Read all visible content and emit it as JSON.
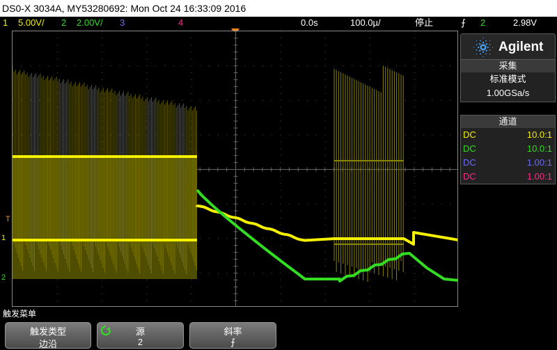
{
  "title": "DS0-X 3034A, MY53280692: Mon Oct 24 16:33:09 2016",
  "status": {
    "ch1_num": "1",
    "ch1_scale": "5.00V/",
    "ch2_num": "2",
    "ch2_scale": "2.00V/",
    "ch3_num": "3",
    "ch4_num": "4",
    "delay": "0.0s",
    "timebase": "100.0µ/",
    "run_state": "停止",
    "trig_slope_symbol": "⨍",
    "trig_source": "2",
    "trig_level": "2.98V"
  },
  "markers": {
    "trigger": "T",
    "ch1": "1",
    "ch2": "2"
  },
  "logo": {
    "brand": "Agilent"
  },
  "acquisition": {
    "header": "采集",
    "mode": "标准模式",
    "rate": "1.00GSa/s"
  },
  "channels": {
    "header": "通道",
    "rows": [
      {
        "coupling": "DC",
        "probe": "10.0:1",
        "color": "#f5f000"
      },
      {
        "coupling": "DC",
        "probe": "10.0:1",
        "color": "#33dd22"
      },
      {
        "coupling": "DC",
        "probe": "1.00:1",
        "color": "#6a6aff"
      },
      {
        "coupling": "DC",
        "probe": "1.00:1",
        "color": "#ff2a8a"
      }
    ]
  },
  "menu": {
    "title": "触发菜单",
    "softkeys": [
      {
        "label": "触发类型",
        "value": "边沿"
      },
      {
        "label": "源",
        "value": "2"
      },
      {
        "label": "斜率",
        "value": "⨍"
      }
    ]
  },
  "colors": {
    "ch1": "#f5f000",
    "ch2": "#33dd22",
    "ch3": "#6a6aff",
    "ch4": "#ff2a8a",
    "trigger_orange": "#ff8c1a"
  }
}
